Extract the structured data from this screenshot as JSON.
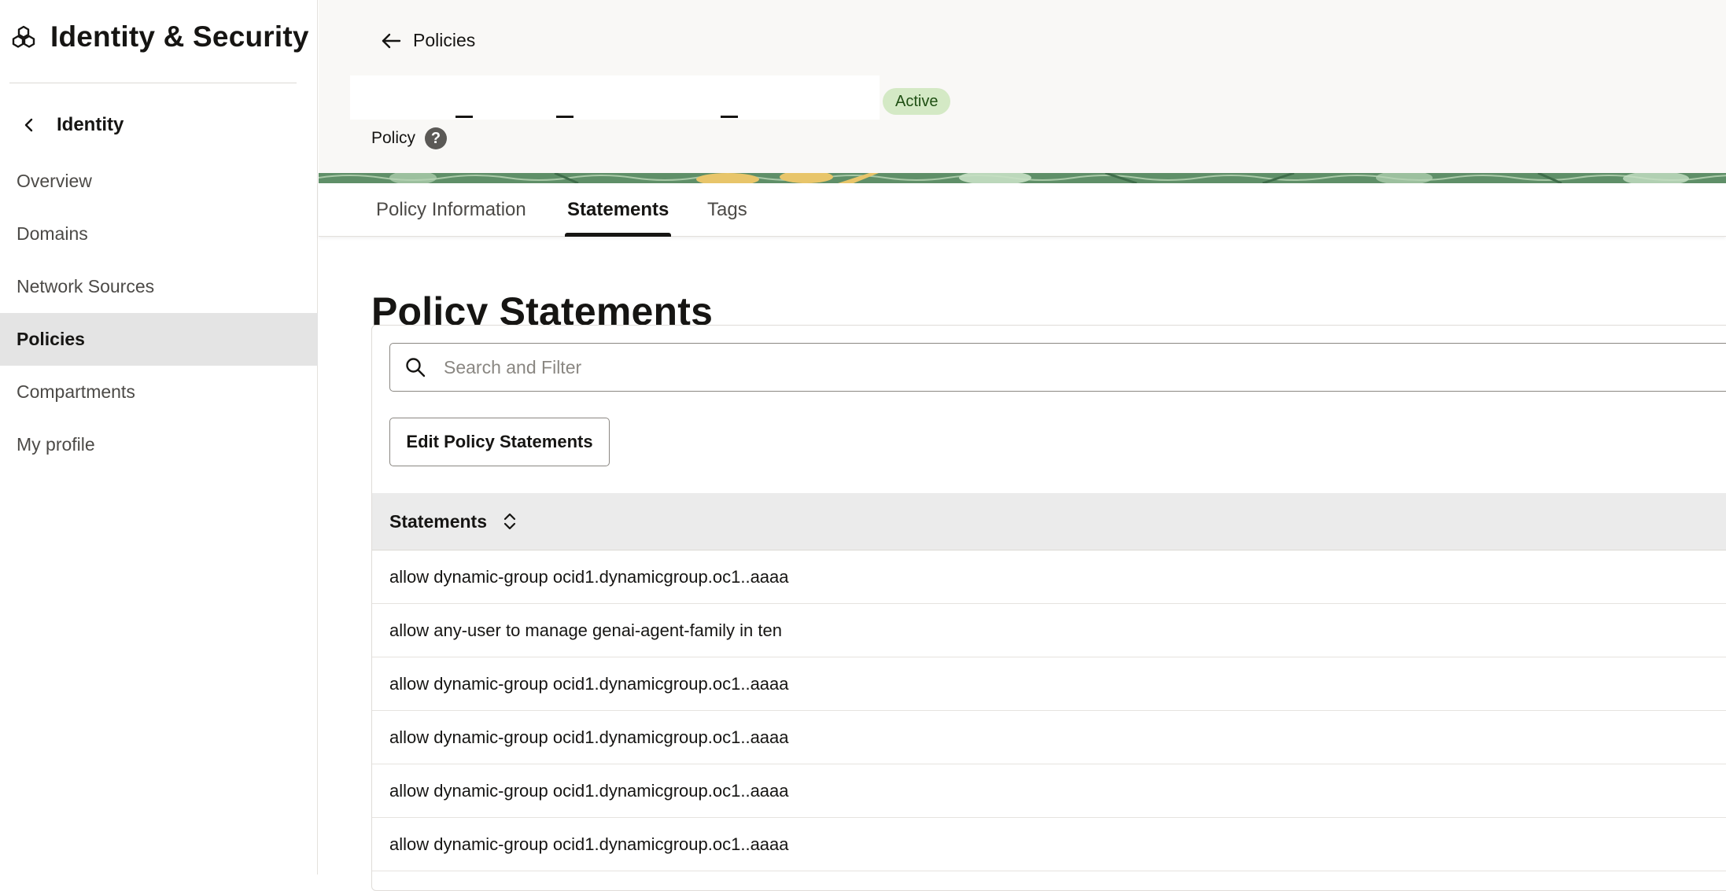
{
  "sidebar": {
    "title": "Identity & Security",
    "logo_icon": "cubes-logo-icon",
    "back_label": "Identity",
    "items": [
      {
        "label": "Overview",
        "active": false
      },
      {
        "label": "Domains",
        "active": false
      },
      {
        "label": "Network Sources",
        "active": false
      },
      {
        "label": "Policies",
        "active": true
      },
      {
        "label": "Compartments",
        "active": false
      },
      {
        "label": "My profile",
        "active": false
      }
    ]
  },
  "header": {
    "back_label": "Policies",
    "status": "Active",
    "resource_type": "Policy",
    "help_glyph": "?"
  },
  "tabs": [
    {
      "label": "Policy Information",
      "active": false
    },
    {
      "label": "Statements",
      "active": true
    },
    {
      "label": "Tags",
      "active": false
    }
  ],
  "content": {
    "title": "Policy Statements",
    "search_placeholder": "Search and Filter",
    "edit_button": "Edit Policy Statements",
    "table": {
      "column_header": "Statements",
      "rows": [
        "allow dynamic-group ocid1.dynamicgroup.oc1..aaaa",
        "allow any-user to manage genai-agent-family in ten",
        "allow dynamic-group ocid1.dynamicgroup.oc1..aaaa",
        "allow dynamic-group ocid1.dynamicgroup.oc1..aaaa",
        "allow dynamic-group ocid1.dynamicgroup.oc1..aaaa",
        "allow dynamic-group ocid1.dynamicgroup.oc1..aaaa"
      ]
    }
  },
  "colors": {
    "header_bg": "#f9f8f6",
    "active_nav_bg": "#e4e4e4",
    "status_badge_bg": "#d4e9c5",
    "table_header_bg": "#ebebeb",
    "banner_green": "#5f8f68",
    "banner_yellow": "#e8c56a"
  }
}
